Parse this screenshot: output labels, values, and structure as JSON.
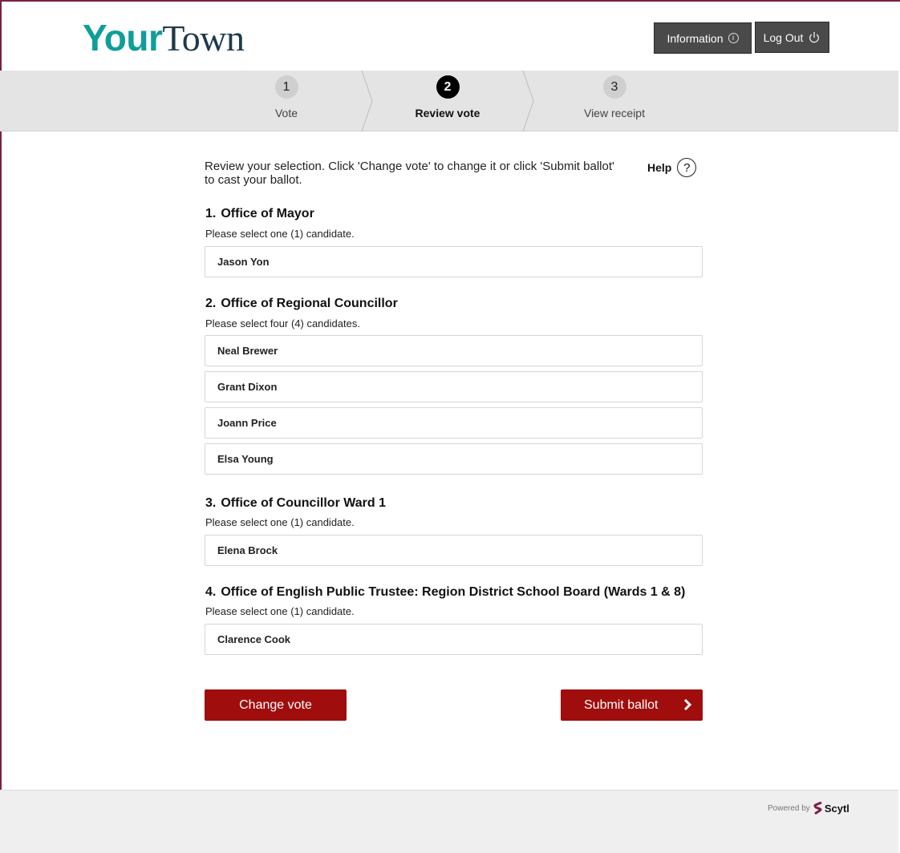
{
  "header": {
    "logo_part1": "Your",
    "logo_part2": "Town",
    "info_label": "Information",
    "logout_label": "Log Out"
  },
  "steps": [
    {
      "num": "1",
      "label": "Vote",
      "active": false
    },
    {
      "num": "2",
      "label": "Review vote",
      "active": true
    },
    {
      "num": "3",
      "label": "View receipt",
      "active": false
    }
  ],
  "intro": {
    "text": "Review your selection. Click 'Change vote' to change it or click 'Submit ballot' to cast your ballot.",
    "help_label": "Help",
    "help_icon": "?"
  },
  "questions": [
    {
      "num": "1.",
      "title": "Office of Mayor",
      "instruction": "Please select one (1) candidate.",
      "selections": [
        "Jason Yon"
      ]
    },
    {
      "num": "2.",
      "title": "Office of Regional Councillor",
      "instruction": "Please select four (4) candidates.",
      "selections": [
        "Neal Brewer",
        "Grant Dixon",
        "Joann Price",
        "Elsa Young"
      ]
    },
    {
      "num": "3.",
      "title": "Office of Councillor Ward 1",
      "instruction": "Please select one (1) candidate.",
      "selections": [
        "Elena Brock"
      ]
    },
    {
      "num": "4.",
      "title": "Office of English Public Trustee: Region District School Board (Wards 1 & 8)",
      "instruction": "Please select one (1) candidate.",
      "selections": [
        "Clarence Cook"
      ]
    }
  ],
  "actions": {
    "change_label": "Change vote",
    "submit_label": "Submit ballot"
  },
  "footer": {
    "powered_by": "Powered by",
    "brand": "Scytl"
  },
  "colors": {
    "accent_red": "#a00d0d",
    "logo_teal": "#0f9e9a",
    "logo_navy": "#1e3a4a",
    "frame_border": "#7a2046"
  },
  "icons": {
    "info": "info-circle-icon",
    "logout": "power-icon",
    "help": "question-circle-icon",
    "submit": "chevron-right-icon",
    "brand": "scytl-logo-icon"
  }
}
